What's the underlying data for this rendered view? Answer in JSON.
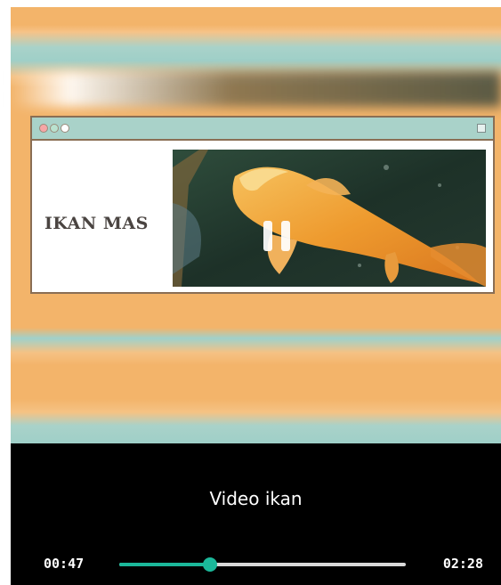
{
  "video": {
    "window": {
      "title_text": "IKAN MAS",
      "traffic_light_colors": [
        "#f6a6a6",
        "#b9e2cf",
        "#ffffff"
      ],
      "titlebar_color": "#a9d2c9"
    },
    "state": "paused",
    "overlay_icon": "pause-icon"
  },
  "caption": "Video ikan",
  "player": {
    "current_time": "00:47",
    "total_time": "02:28",
    "progress": 0.318,
    "accent_color": "#1bb89a"
  }
}
